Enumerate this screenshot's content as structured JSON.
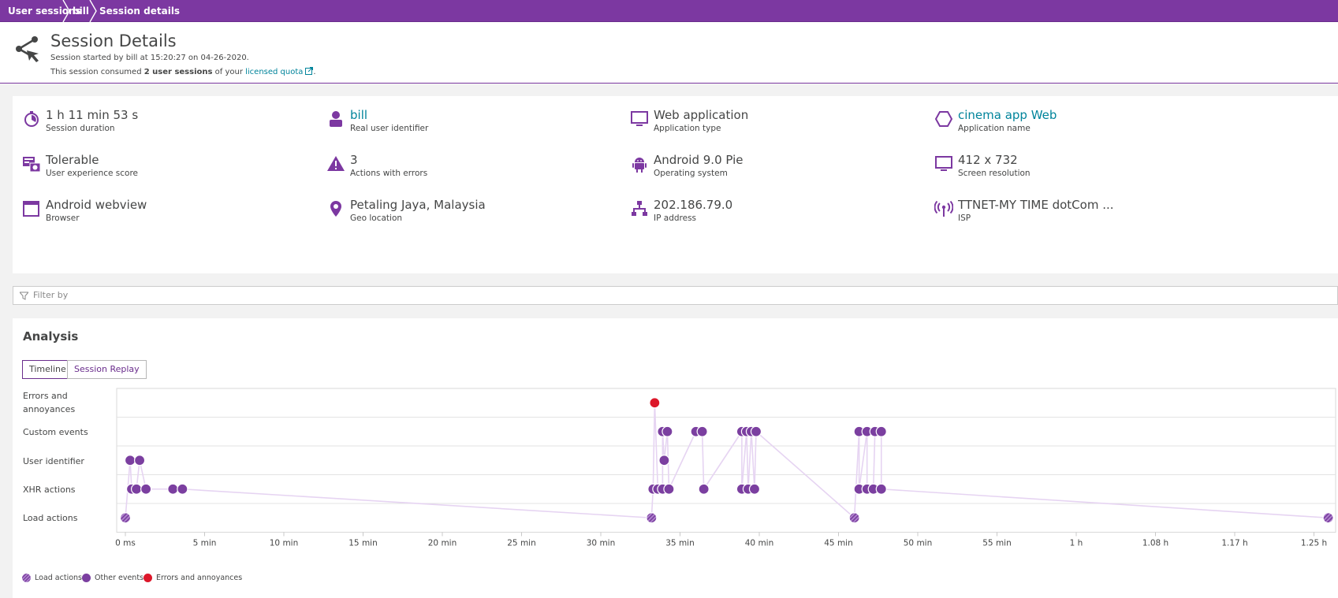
{
  "breadcrumb": [
    "User sessions",
    "bill",
    "Session details"
  ],
  "header": {
    "title": "Session Details",
    "line1": "Session started by bill at 15:20:27 on 04-26-2020.",
    "line2_prefix": "This session consumed ",
    "line2_bold": "2 user sessions",
    "line2_mid": " of your ",
    "line2_link": "licensed quota",
    "line2_suffix": "."
  },
  "properties": [
    {
      "value": "1 h 11 min 53 s",
      "label": "Session duration",
      "icon": "stopwatch-icon",
      "link": false
    },
    {
      "value": "bill",
      "label": "Real user identifier",
      "icon": "user-icon",
      "link": true
    },
    {
      "value": "Web application",
      "label": "Application type",
      "icon": "monitor-icon",
      "link": false
    },
    {
      "value": "cinema app Web",
      "label": "Application name",
      "icon": "hexagon-icon",
      "link": true
    },
    {
      "value": "Tolerable",
      "label": "User experience score",
      "icon": "ux-score-icon",
      "link": false
    },
    {
      "value": "3",
      "label": "Actions with errors",
      "icon": "warning-icon",
      "link": false
    },
    {
      "value": "Android 9.0 Pie",
      "label": "Operating system",
      "icon": "android-icon",
      "link": false
    },
    {
      "value": "412 x 732",
      "label": "Screen resolution",
      "icon": "screen-icon",
      "link": false
    },
    {
      "value": "Android webview",
      "label": "Browser",
      "icon": "browser-icon",
      "link": false
    },
    {
      "value": "Petaling Jaya, Malaysia",
      "label": "Geo location",
      "icon": "location-pin-icon",
      "link": false
    },
    {
      "value": "202.186.79.0",
      "label": "IP address",
      "icon": "network-icon",
      "link": false
    },
    {
      "value": "TTNET-MY TIME dotCom ...",
      "label": "ISP",
      "icon": "antenna-icon",
      "link": false
    }
  ],
  "filter": {
    "placeholder": "Filter by"
  },
  "analysis": {
    "title": "Analysis",
    "tabs": [
      {
        "label": "Timeline",
        "active": true
      },
      {
        "label": "Session Replay",
        "active": false
      }
    ]
  },
  "colors": {
    "brand": "#7c38a1",
    "event": "#7b3fa0",
    "error": "#dc172a",
    "link": "#00849b",
    "connector": "#e6d4f2"
  },
  "chart_data": {
    "type": "scatter",
    "title": "",
    "rows": [
      "Errors and annoyances",
      "Custom events",
      "User identifier",
      "XHR actions",
      "Load actions"
    ],
    "x_unit": "min",
    "xlim": [
      0,
      76
    ],
    "x_ticks": [
      {
        "v": 0,
        "label": "0 ms"
      },
      {
        "v": 5,
        "label": "5 min"
      },
      {
        "v": 10,
        "label": "10 min"
      },
      {
        "v": 15,
        "label": "15 min"
      },
      {
        "v": 20,
        "label": "20 min"
      },
      {
        "v": 25,
        "label": "25 min"
      },
      {
        "v": 30,
        "label": "30 min"
      },
      {
        "v": 35,
        "label": "35 min"
      },
      {
        "v": 40,
        "label": "40 min"
      },
      {
        "v": 45,
        "label": "45 min"
      },
      {
        "v": 50,
        "label": "50 min"
      },
      {
        "v": 55,
        "label": "55 min"
      },
      {
        "v": 60,
        "label": "1 h"
      },
      {
        "v": 65,
        "label": "1.08 h"
      },
      {
        "v": 70,
        "label": "1.17 h"
      },
      {
        "v": 75,
        "label": "1.25 h"
      }
    ],
    "events": [
      {
        "row": 4,
        "x": 0.0,
        "kind": "load"
      },
      {
        "row": 2,
        "x": 0.3,
        "kind": "other"
      },
      {
        "row": 2,
        "x": 0.9,
        "kind": "other"
      },
      {
        "row": 3,
        "x": 0.4,
        "kind": "other"
      },
      {
        "row": 3,
        "x": 0.7,
        "kind": "other"
      },
      {
        "row": 3,
        "x": 1.3,
        "kind": "other"
      },
      {
        "row": 3,
        "x": 3.0,
        "kind": "other"
      },
      {
        "row": 3,
        "x": 3.6,
        "kind": "other"
      },
      {
        "row": 4,
        "x": 33.2,
        "kind": "load"
      },
      {
        "row": 0,
        "x": 33.4,
        "kind": "error"
      },
      {
        "row": 3,
        "x": 33.3,
        "kind": "other"
      },
      {
        "row": 3,
        "x": 33.6,
        "kind": "other"
      },
      {
        "row": 3,
        "x": 33.9,
        "kind": "other"
      },
      {
        "row": 3,
        "x": 34.3,
        "kind": "other"
      },
      {
        "row": 1,
        "x": 33.9,
        "kind": "other"
      },
      {
        "row": 1,
        "x": 34.2,
        "kind": "other"
      },
      {
        "row": 2,
        "x": 34.0,
        "kind": "other"
      },
      {
        "row": 1,
        "x": 36.0,
        "kind": "other"
      },
      {
        "row": 1,
        "x": 36.4,
        "kind": "other"
      },
      {
        "row": 3,
        "x": 36.5,
        "kind": "other"
      },
      {
        "row": 1,
        "x": 38.9,
        "kind": "other"
      },
      {
        "row": 1,
        "x": 39.2,
        "kind": "other"
      },
      {
        "row": 1,
        "x": 39.5,
        "kind": "other"
      },
      {
        "row": 1,
        "x": 39.8,
        "kind": "other"
      },
      {
        "row": 3,
        "x": 38.9,
        "kind": "other"
      },
      {
        "row": 3,
        "x": 39.3,
        "kind": "other"
      },
      {
        "row": 3,
        "x": 39.7,
        "kind": "other"
      },
      {
        "row": 4,
        "x": 46.0,
        "kind": "load"
      },
      {
        "row": 1,
        "x": 46.3,
        "kind": "other"
      },
      {
        "row": 1,
        "x": 46.8,
        "kind": "other"
      },
      {
        "row": 1,
        "x": 47.3,
        "kind": "other"
      },
      {
        "row": 1,
        "x": 47.7,
        "kind": "other"
      },
      {
        "row": 3,
        "x": 46.3,
        "kind": "other"
      },
      {
        "row": 3,
        "x": 46.8,
        "kind": "other"
      },
      {
        "row": 3,
        "x": 47.2,
        "kind": "other"
      },
      {
        "row": 3,
        "x": 47.7,
        "kind": "other"
      },
      {
        "row": 4,
        "x": 75.9,
        "kind": "load"
      }
    ],
    "legend": [
      {
        "label": "Load actions",
        "kind": "load"
      },
      {
        "label": "Other events",
        "kind": "other"
      },
      {
        "label": "Errors and annoyances",
        "kind": "error"
      }
    ]
  }
}
